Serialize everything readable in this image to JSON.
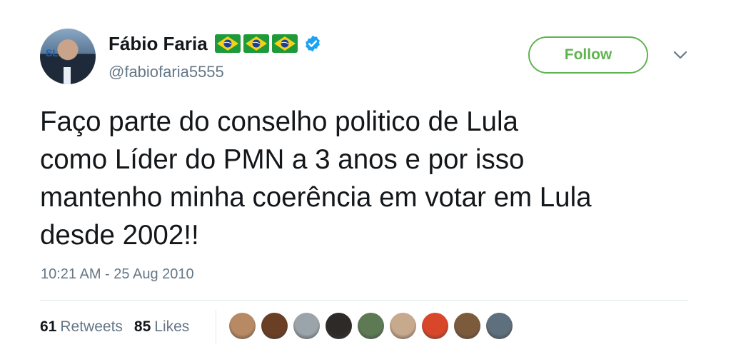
{
  "user": {
    "name": "Fábio Faria",
    "handle": "@fabiofaria5555",
    "flags": [
      "brazil-flag-icon",
      "brazil-flag-icon",
      "brazil-flag-icon"
    ],
    "verified_icon": "verified-badge-icon",
    "avatar_logo": "SL"
  },
  "follow_label": "Follow",
  "menu_icon": "chevron-down-icon",
  "tweet": {
    "text": "Faço parte do conselho politico de Lula\ncomo Líder do PMN a 3 anos e por isso\nmantenho minha coerência em votar em Lula\ndesde 2002!!",
    "timestamp": "10:21 AM - 25 Aug 2010"
  },
  "stats": {
    "retweets_count": "61",
    "retweets_label": "Retweets",
    "likes_count": "85",
    "likes_label": "Likes"
  },
  "likers": [
    {
      "name": "liker-avatar-1",
      "color": "#b88a64"
    },
    {
      "name": "liker-avatar-2",
      "color": "#6b3f25"
    },
    {
      "name": "liker-avatar-3",
      "color": "#9aa4aa"
    },
    {
      "name": "liker-avatar-4",
      "color": "#2e2a27"
    },
    {
      "name": "liker-avatar-5",
      "color": "#5d7a55"
    },
    {
      "name": "liker-avatar-6",
      "color": "#c7a98e"
    },
    {
      "name": "liker-avatar-7",
      "color": "#d9472b"
    },
    {
      "name": "liker-avatar-8",
      "color": "#7c5b3d"
    },
    {
      "name": "liker-avatar-9",
      "color": "#5e6f7d"
    }
  ],
  "colors": {
    "accent": "#5fb350",
    "muted": "#657786",
    "text": "#14171a",
    "verified": "#1da1f2",
    "divider": "#e1e8ed"
  }
}
